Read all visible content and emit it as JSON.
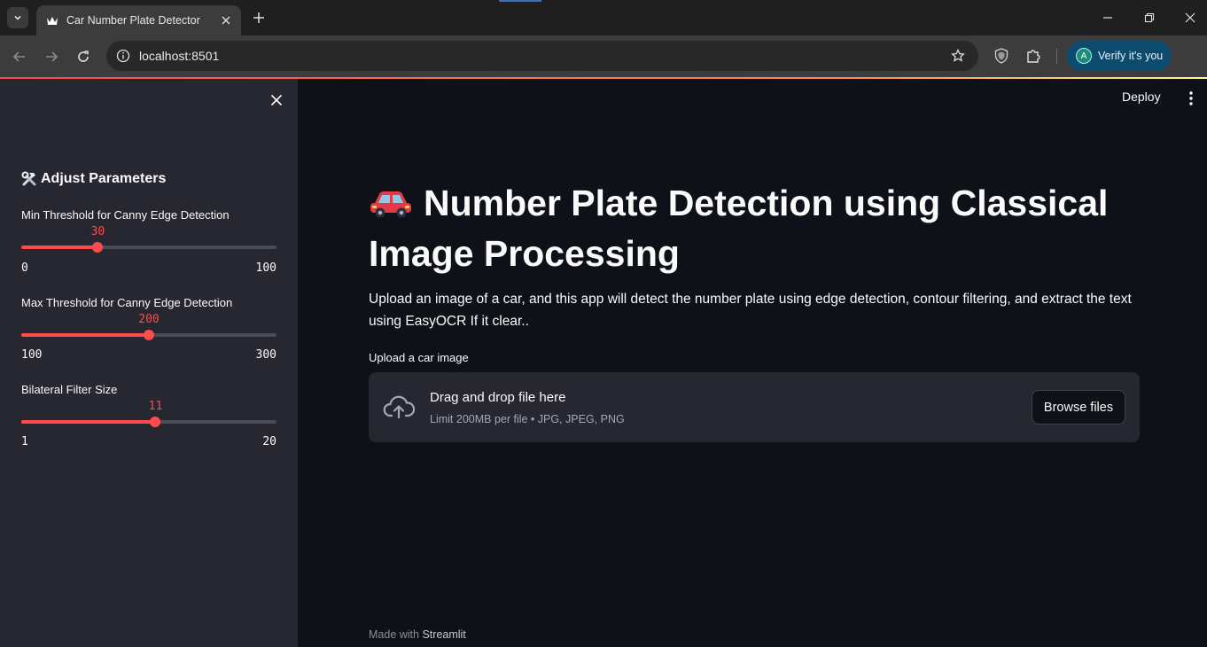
{
  "browser": {
    "tab_title": "Car Number Plate Detector",
    "url": "localhost:8501",
    "verify_label": "Verify it's you",
    "avatar_initial": "A"
  },
  "sidebar": {
    "heading_icon": "hammer-and-wrench-icon",
    "heading": "Adjust Parameters",
    "sliders": [
      {
        "label": "Min Threshold for Canny Edge Detection",
        "value": "30",
        "min": "0",
        "max": "100",
        "fraction": 0.3
      },
      {
        "label": "Max Threshold for Canny Edge Detection",
        "value": "200",
        "min": "100",
        "max": "300",
        "fraction": 0.5
      },
      {
        "label": "Bilateral Filter Size",
        "value": "11",
        "min": "1",
        "max": "20",
        "fraction": 0.526
      }
    ]
  },
  "header": {
    "deploy_label": "Deploy"
  },
  "main": {
    "title_emoji": "car-icon",
    "title": "Number Plate Detection using Classical Image Processing",
    "description": "Upload an image of a car, and this app will detect the number plate using edge detection, contour filtering, and extract the text using EasyOCR If it clear..",
    "uploader": {
      "label": "Upload a car image",
      "dropzone_title": "Drag and drop file here",
      "dropzone_subtitle": "Limit 200MB per file • JPG, JPEG, PNG",
      "browse_label": "Browse files"
    },
    "footer_prefix": "Made with",
    "footer_brand": "Streamlit"
  },
  "colors": {
    "accent": "#ff4b4b",
    "sidebar_bg": "#262730",
    "main_bg": "#0e1117"
  }
}
